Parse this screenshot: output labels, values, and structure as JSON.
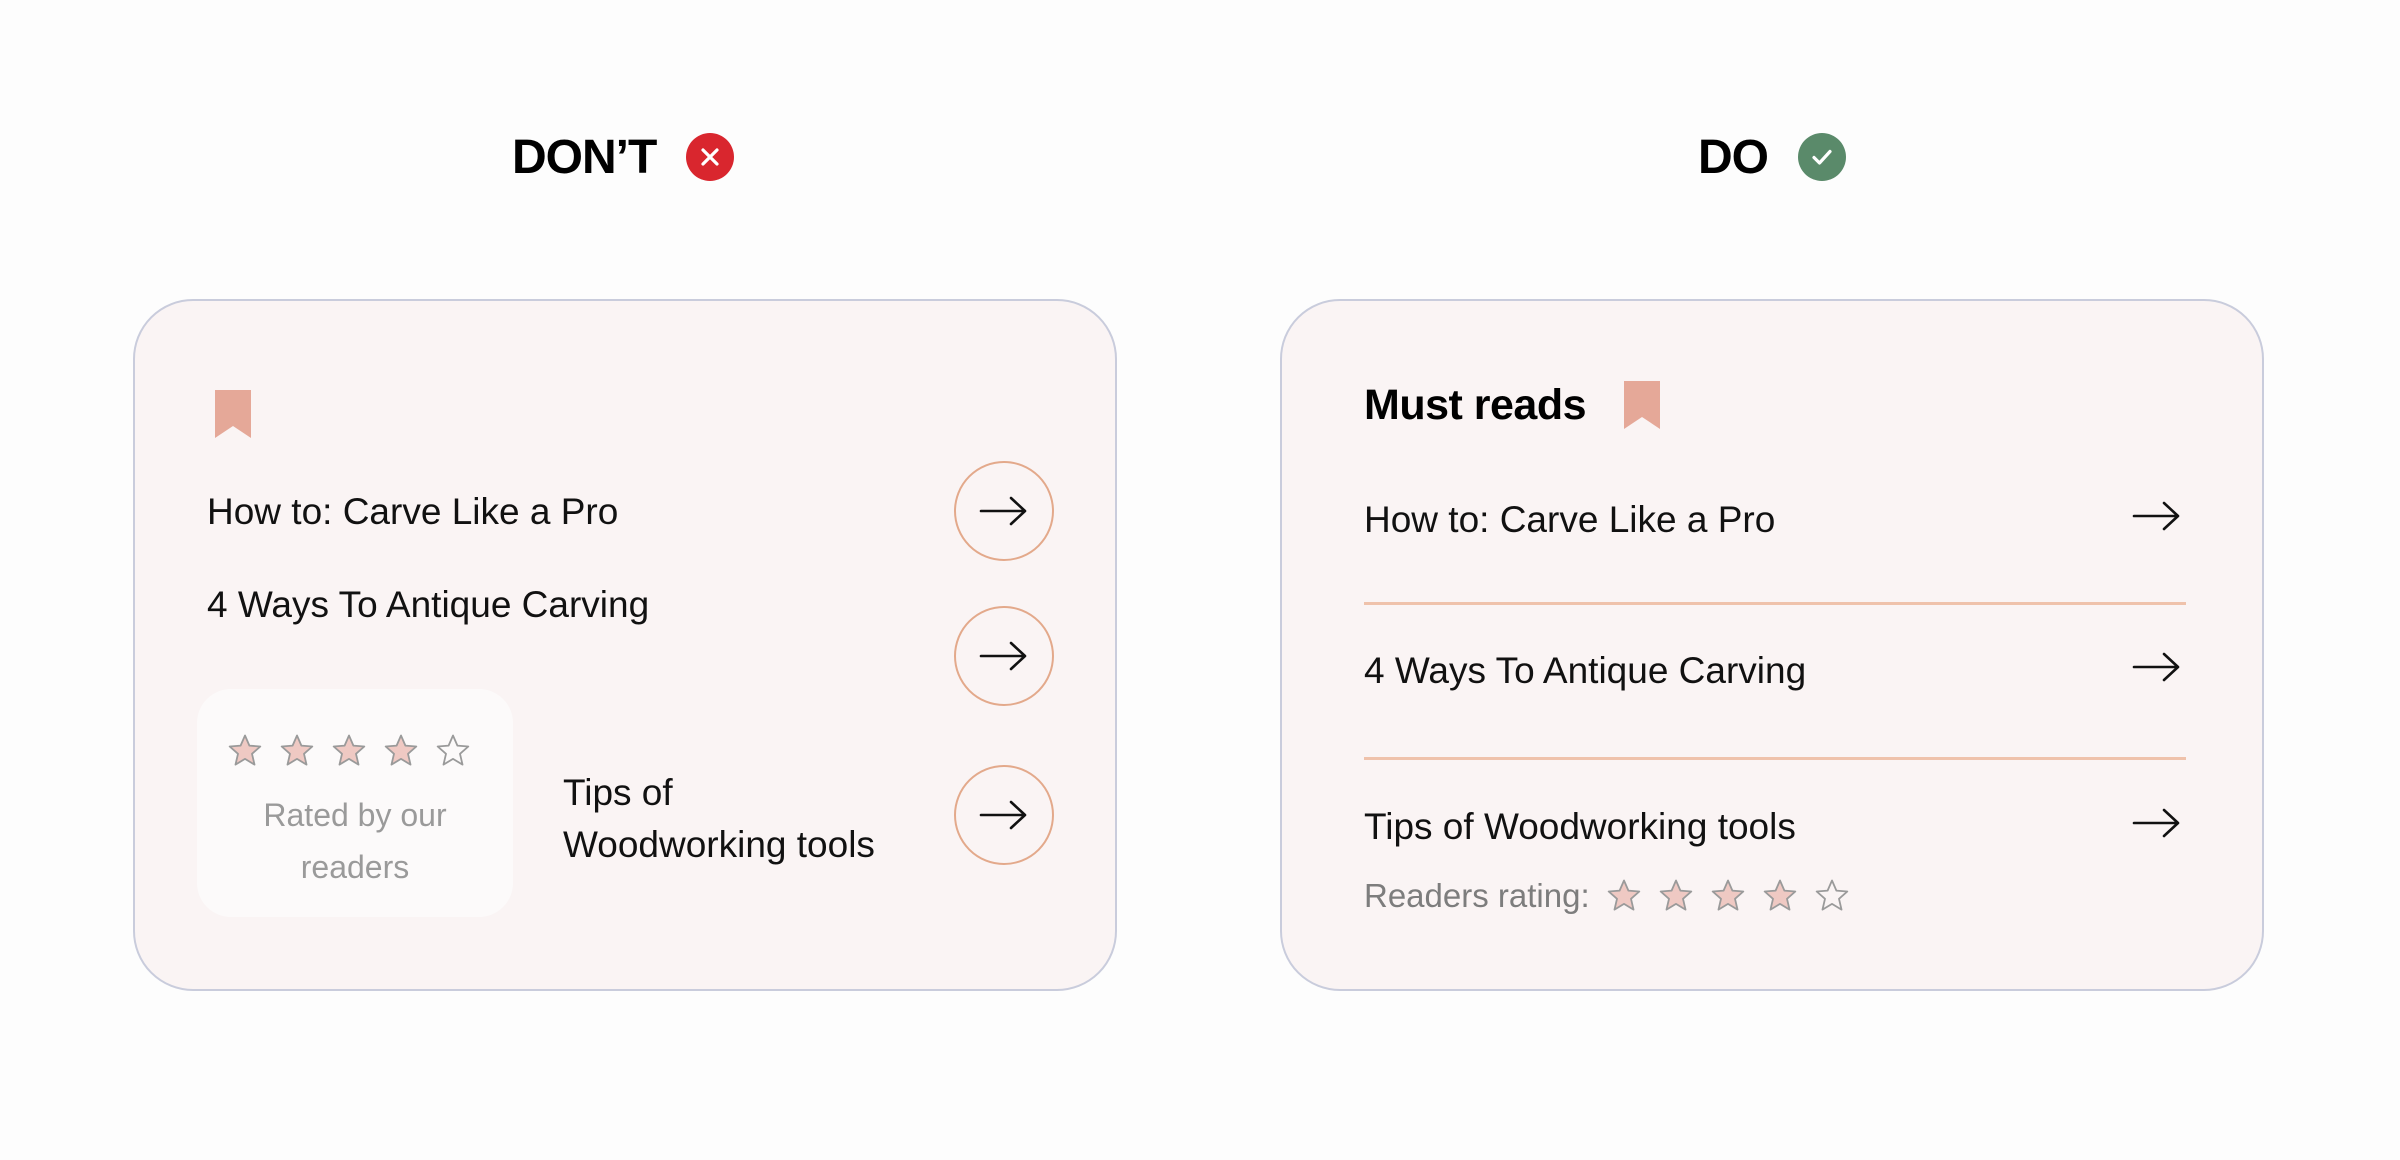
{
  "colors": {
    "error_red": "#d9262e",
    "success_green": "#5a8a6a",
    "accent_peach": "#e3a98b",
    "bookmark": "#e5a898",
    "star_fill": "#efc9c3"
  },
  "dont": {
    "heading": "DON’T",
    "badge_icon": "close-icon",
    "items": [
      {
        "label": "How to: Carve Like a Pro"
      },
      {
        "label": "4 Ways To Antique Carving"
      },
      {
        "label_line1": "Tips of",
        "label_line2": "Woodworking tools"
      }
    ],
    "rating": {
      "value": 4,
      "max": 5,
      "caption_line1": "Rated by our",
      "caption_line2": "readers"
    }
  },
  "do": {
    "heading": "DO",
    "badge_icon": "check-icon",
    "section_title": "Must reads",
    "items": [
      {
        "label": "How to: Carve Like a Pro"
      },
      {
        "label": "4 Ways To Antique Carving"
      },
      {
        "label": "Tips of Woodworking tools"
      }
    ],
    "rating": {
      "label": "Readers rating:",
      "value": 4,
      "max": 5
    }
  }
}
